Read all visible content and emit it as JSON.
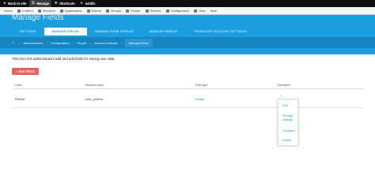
{
  "toolbar": {
    "back_to_site": "Back to site",
    "manage": "Manage",
    "shortcuts": "Shortcuts",
    "user": "sahillc"
  },
  "tray": [
    "Home",
    "Content",
    "Structure",
    "Appearance",
    "Extend",
    "Groups",
    "People",
    "Reports",
    "Configuration",
    "Help",
    "Elixir"
  ],
  "page": {
    "title": "Manage Fields"
  },
  "tabs": [
    "SETTINGS",
    "MANAGE FIELDS",
    "MANAGE FORM DISPLAY",
    "MANAGE DISPLAY",
    "TRANSLATE ACCOUNT SETTINGS"
  ],
  "breadcrumbs": [
    "Administration",
    "Configuration",
    "People",
    "Account settings",
    "Manage fields"
  ],
  "intro_text": "This form lets administrators add and edit fields for storing user data.",
  "add_field_label": "+ ADD FIELD",
  "table": {
    "headers": [
      "Label",
      "Machine name",
      "Field type",
      "Operations"
    ],
    "rows": [
      {
        "label": "Picture",
        "machine_name": "user_picture",
        "field_type": "Image",
        "ops": "↕"
      }
    ]
  },
  "dropdown": {
    "items": [
      "Edit",
      "Storage settings",
      "Translate",
      "Delete"
    ]
  },
  "colors": {
    "header_bg": "#1a9ee0",
    "breadcrumb_bg": "#1585bf",
    "accent_button": "#e8635f",
    "link": "#1a9ee0",
    "toolbar_bg": "#0f0f0f"
  }
}
